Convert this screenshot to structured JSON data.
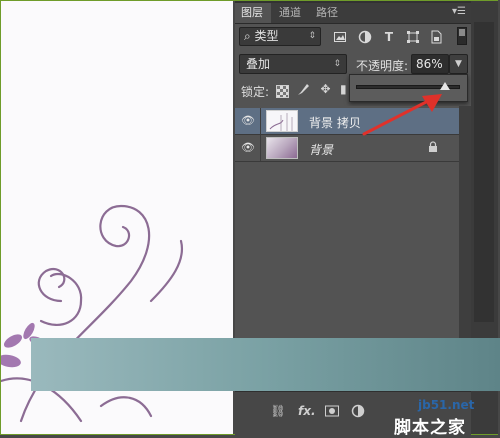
{
  "panel": {
    "tabs": [
      {
        "label": "图层",
        "active": true
      },
      {
        "label": "通道",
        "active": false
      },
      {
        "label": "路径",
        "active": false
      }
    ],
    "menu_icon": "panel-menu-icon",
    "filter": {
      "label": "类型",
      "icon": "search-icon",
      "icons": [
        "image-filter-icon",
        "adjustment-filter-icon",
        "type-filter-icon",
        "shape-filter-icon",
        "smart-object-filter-icon"
      ]
    },
    "blend_mode": "叠加",
    "opacity": {
      "label": "不透明度:",
      "value": "86%",
      "slider_level": 0.86
    },
    "lock": {
      "label": "锁定:",
      "icons": [
        "lock-transparent-icon",
        "lock-image-icon",
        "lock-position-icon"
      ]
    },
    "layers": [
      {
        "name": "背景 拷贝",
        "visible": true,
        "selected": true
      },
      {
        "name": "背景",
        "visible": true,
        "selected": false,
        "locked": true
      }
    ],
    "bottom_icons": [
      "link-layers-icon",
      "fx-icon",
      "add-mask-icon",
      "adjustment-layer-icon"
    ],
    "bottom_fx_label": "fx."
  },
  "colors": {
    "selected_layer": "#5e6f84",
    "annotation_arrow": "#e0312a",
    "overlay_block": "#7aa1a4"
  },
  "watermark": {
    "url": "jb51.net",
    "site": "脚本之家"
  }
}
